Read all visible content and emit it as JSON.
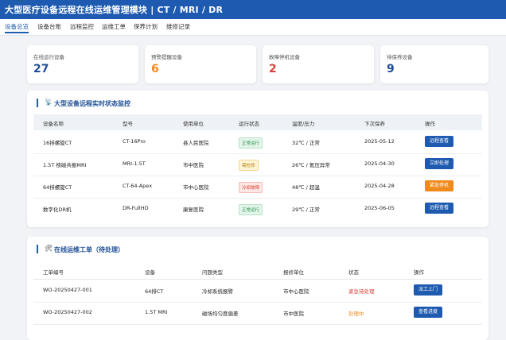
{
  "header": {
    "title": "大型医疗设备远程在线运维管理模块 | CT / MRI / DR"
  },
  "tabs": [
    {
      "label": "设备总览",
      "active": true
    },
    {
      "label": "设备台账"
    },
    {
      "label": "远程监控"
    },
    {
      "label": "运维工单"
    },
    {
      "label": "保养计划"
    },
    {
      "label": "维修记录"
    }
  ],
  "stats": [
    {
      "label": "在线运行设备",
      "value": "27",
      "color": "#1e4f96"
    },
    {
      "label": "预警提醒设备",
      "value": "6",
      "color": "#f08a1c"
    },
    {
      "label": "故障停机设备",
      "value": "2",
      "color": "#d8443a"
    },
    {
      "label": "待保养设备",
      "value": "9",
      "color": "#1e4f96"
    }
  ],
  "monitor": {
    "title": "大型设备远程实时状态监控",
    "icon": "satellite-icon",
    "headers": [
      "设备名称",
      "型号",
      "使用单位",
      "运行状态",
      "温度/压力",
      "下次保养",
      "操作"
    ],
    "rows": [
      {
        "name": "16排螺旋CT",
        "model": "CT-16Pro",
        "unit": "县人民医院",
        "status": "正常运行",
        "status_color": "green",
        "temp": "32℃ / 正常",
        "next": "2025-05-12",
        "action": "远程查看",
        "action_color": "blue"
      },
      {
        "name": "1.5T 核磁共振MRI",
        "model": "MRI-1.5T",
        "unit": "市中医院",
        "status": "需检修",
        "status_color": "yellow",
        "temp": "26℃ / 氦压异常",
        "next": "2025-04-30",
        "action": "立即处理",
        "action_color": "blue"
      },
      {
        "name": "64排螺旋CT",
        "model": "CT-64-Apex",
        "unit": "市中心医院",
        "status": "冷却故障",
        "status_color": "red",
        "temp": "48℃ / 超温",
        "next": "2025-04-28",
        "action": "紧急停机",
        "action_color": "orange"
      },
      {
        "name": "数字化DR机",
        "model": "DR-FullHD",
        "unit": "康复医院",
        "status": "正常运行",
        "status_color": "green",
        "temp": "29℃ / 正常",
        "next": "2025-06-05",
        "action": "远程查看",
        "action_color": "blue"
      }
    ]
  },
  "orders": {
    "title": "在线运维工单（待处理）",
    "icon": "wrench-icon",
    "headers": [
      "工单编号",
      "设备",
      "问题类型",
      "报修单位",
      "状态",
      "操作"
    ],
    "rows": [
      {
        "id": "WO-20250427-001",
        "device": "64排CT",
        "issue": "冷却系统报警",
        "unit": "市中心医院",
        "status": "紧急待处理",
        "status_color": "#d8443a",
        "action": "派工上门"
      },
      {
        "id": "WO-20250427-002",
        "device": "1.5T MRI",
        "issue": "磁场均匀度偏差",
        "unit": "市中医院",
        "status": "处理中",
        "status_color": "#f08a1c",
        "action": "查看进度"
      }
    ]
  }
}
